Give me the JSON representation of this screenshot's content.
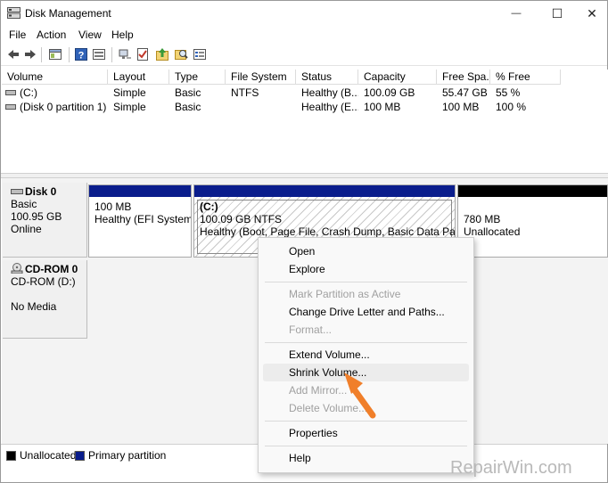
{
  "window": {
    "title": "Disk Management",
    "minimize_glyph": "—",
    "maximize_glyph": "☐",
    "close_glyph": "✕"
  },
  "menu": [
    "File",
    "Action",
    "View",
    "Help"
  ],
  "toolbar_icons": [
    "back-icon",
    "forward-icon",
    "properties-icon",
    "help-icon",
    "console-icon",
    "connect-icon",
    "check-icon",
    "upload-icon",
    "search-icon",
    "list-icon"
  ],
  "volume_list": {
    "columns": [
      "Volume",
      "Layout",
      "Type",
      "File System",
      "Status",
      "Capacity",
      "Free Spa...",
      "% Free"
    ],
    "rows": [
      [
        "(C:)",
        "Simple",
        "Basic",
        "NTFS",
        "Healthy (B...",
        "100.09 GB",
        "55.47 GB",
        "55 %"
      ],
      [
        "(Disk 0 partition 1)",
        "Simple",
        "Basic",
        "",
        "Healthy (E...",
        "100 MB",
        "100 MB",
        "100 %"
      ]
    ]
  },
  "disks": [
    {
      "name": "Disk 0",
      "type": "Basic",
      "size": "100.95 GB",
      "state": "Online",
      "partitions": [
        {
          "title": "",
          "size": "100 MB",
          "status": "Healthy (EFI System P"
        },
        {
          "title": "(C:)",
          "size": "100.09 GB NTFS",
          "status": "Healthy (Boot, Page File, Crash Dump, Basic Data Partition)"
        },
        {
          "title": "",
          "size": "780 MB",
          "status": "Unallocated"
        }
      ]
    },
    {
      "name": "CD-ROM 0",
      "type": "CD-ROM (D:)",
      "size": "",
      "state": "No Media"
    }
  ],
  "legend": [
    {
      "label": "Unallocated",
      "color": "#000000"
    },
    {
      "label": "Primary partition",
      "color": "#0a1d8c"
    }
  ],
  "context_menu": {
    "items": [
      {
        "label": "Open",
        "enabled": true
      },
      {
        "label": "Explore",
        "enabled": true
      },
      {
        "label": "Mark Partition as Active",
        "enabled": false
      },
      {
        "label": "Change Drive Letter and Paths...",
        "enabled": true
      },
      {
        "label": "Format...",
        "enabled": false
      },
      {
        "label": "Extend Volume...",
        "enabled": true
      },
      {
        "label": "Shrink Volume...",
        "enabled": true,
        "highlighted": true
      },
      {
        "label": "Add Mirror...",
        "enabled": false
      },
      {
        "label": "Delete Volume...",
        "enabled": false
      },
      {
        "label": "Properties",
        "enabled": true
      },
      {
        "label": "Help",
        "enabled": true
      }
    ]
  },
  "watermark": "RepairWin.com",
  "colors": {
    "primary_partition": "#0a1d8c",
    "unallocated": "#000000",
    "arrow": "#f07f2a"
  }
}
